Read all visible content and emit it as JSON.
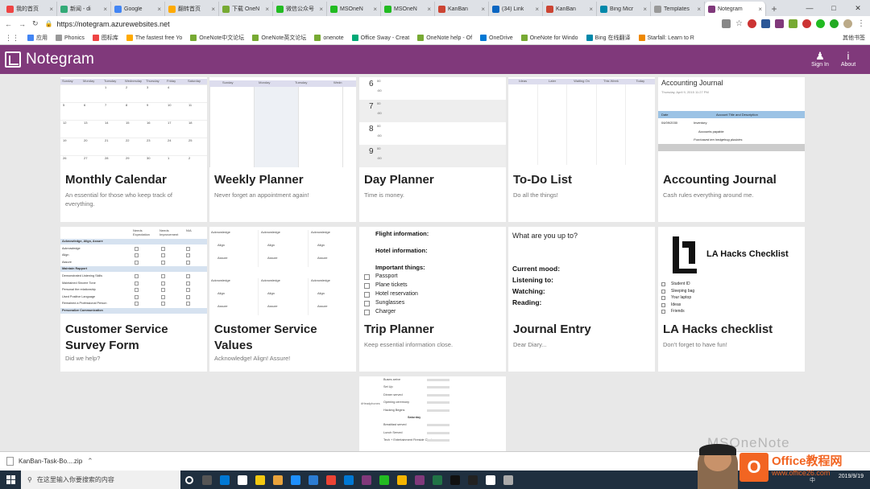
{
  "browser": {
    "tabs": [
      {
        "label": "我的首页",
        "color": "#e44"
      },
      {
        "label": "新闻 - di",
        "color": "#3a7"
      },
      {
        "label": "Google",
        "color": "#4285f4"
      },
      {
        "label": "翻转首页",
        "color": "#fa0"
      },
      {
        "label": "下载 OneN",
        "color": "#7a3"
      },
      {
        "label": "微信公众号",
        "color": "#2b2"
      },
      {
        "label": "MSOneN",
        "color": "#2b2"
      },
      {
        "label": "MSOneN",
        "color": "#2b2"
      },
      {
        "label": "KanBan",
        "color": "#c43"
      },
      {
        "label": "(34) Link",
        "color": "#0a66c2"
      },
      {
        "label": "KanBan",
        "color": "#c43"
      },
      {
        "label": "Bing Micr",
        "color": "#08a"
      },
      {
        "label": "Templates",
        "color": "#999"
      },
      {
        "label": "Notegram",
        "color": "#80397b",
        "active": true
      }
    ],
    "url": "https://notegram.azurewebsites.net",
    "bookmarks": [
      {
        "label": "应用",
        "color": "#4285f4"
      },
      {
        "label": "Phonics",
        "color": "#999"
      },
      {
        "label": "图标库",
        "color": "#e44"
      },
      {
        "label": "The fastest free Yo",
        "color": "#fa0"
      },
      {
        "label": "OneNote中文论坛",
        "color": "#7a3"
      },
      {
        "label": "OneNote英文论坛",
        "color": "#7a3"
      },
      {
        "label": "onenote",
        "color": "#7a3"
      },
      {
        "label": "Office Sway - Creat",
        "color": "#0a7"
      },
      {
        "label": "OneNote help - Of",
        "color": "#7a3"
      },
      {
        "label": "OneDrive",
        "color": "#0078d4"
      },
      {
        "label": "OneNote for Windo",
        "color": "#7a3"
      },
      {
        "label": "Bing 在线翻译",
        "color": "#08a"
      },
      {
        "label": "Starfall: Learn to R",
        "color": "#e80"
      }
    ],
    "other_bookmarks": "其他书签"
  },
  "app": {
    "name": "Notegram",
    "sign_in": "Sign In",
    "about": "About",
    "brand_color": "#80397b"
  },
  "cards": [
    {
      "title": "Monthly Calendar",
      "desc": "An essential for those who keep track of everything."
    },
    {
      "title": "Weekly Planner",
      "desc": "Never forget an appointment again!"
    },
    {
      "title": "Day Planner",
      "desc": "Time is money."
    },
    {
      "title": "To-Do List",
      "desc": "Do all the things!"
    },
    {
      "title": "Accounting Journal",
      "desc": "Cash rules everything around me."
    },
    {
      "title": "Customer Service Survey Form",
      "desc": "Did we help?"
    },
    {
      "title": "Customer Service Values",
      "desc": "Acknowledge! Align! Assure!"
    },
    {
      "title": "Trip Planner",
      "desc": "Keep essential information close."
    },
    {
      "title": "Journal Entry",
      "desc": "Dear Diary..."
    },
    {
      "title": "LA Hacks checklist",
      "desc": "Don't forget to have fun!"
    }
  ],
  "thumbs": {
    "monthly_days": [
      "Sunday",
      "Monday",
      "Tuesday",
      "Wednesday",
      "Thursday",
      "Friday",
      "Saturday"
    ],
    "monthly_rows": [
      [
        "",
        "",
        "1",
        "2",
        "3",
        "4"
      ],
      [
        "5",
        "6",
        "7",
        "8",
        "9",
        "10",
        "11"
      ],
      [
        "12",
        "13",
        "14",
        "15",
        "16",
        "17",
        "18"
      ],
      [
        "19",
        "20",
        "21",
        "22",
        "23",
        "24",
        "25"
      ],
      [
        "26",
        "27",
        "28",
        "29",
        "30",
        "1",
        "2"
      ]
    ],
    "weekly_days": [
      "Sunday",
      "Monday",
      "Tuesday",
      "Wedn"
    ],
    "day_hours": [
      "6",
      "7",
      "8",
      "9"
    ],
    "day_sup": "00",
    "day_sub": ":00",
    "todo_cols": [
      "Ideas",
      "Later",
      "Waiting On",
      "This Week",
      "Today"
    ],
    "acct_title": "Accounting Journal",
    "acct_date": "Thursday, April 9, 2015     11:27 PM",
    "acct_h1": "Date",
    "acct_h2": "Account Title and Description",
    "acct_r1a": "04/09/2030",
    "acct_r1b": "Inventory",
    "acct_r2": "Accounts payable",
    "acct_r3": "Purchased ten hedgehog plushies",
    "survey_cols": [
      "Needs Expectation",
      "Needs Improvement",
      "N/A"
    ],
    "survey_rows": [
      "Acknowledge, Align, Assure",
      "Acknowledge",
      "Align",
      "Assure",
      "Maintain Rapport",
      "Demonstrated Listening Skills",
      "Maintained Sincere Tone",
      "Personal the relationship",
      "Used Positive Language",
      "Remained a Professional Person",
      "Personalize Communication"
    ],
    "values_cells": [
      "Acknowledge",
      "Align",
      "Assure"
    ],
    "trip_lines": [
      "Flight information:",
      "Hotel information:",
      "Important things:"
    ],
    "trip_items": [
      "Passport",
      "Plane tickets",
      "Hotel reservation",
      "Sunglasses",
      "Charger"
    ],
    "journal_q": "What are you up to?",
    "journal_lines": [
      "Current mood:",
      "Listening to:",
      "Watching:",
      "Reading:"
    ],
    "la_title": "LA Hacks Checklist",
    "la_items": [
      "Student ID",
      "Sleeping bag",
      "Your laptop",
      "Ideas",
      "Friends"
    ],
    "extra_lines": [
      "Buses arrive",
      "Set Up",
      "Dinner served",
      "Opening ceremony",
      "Hacking Begins",
      "Saturday",
      "Breakfast served",
      "Lunch Served",
      "Tech + Entertainment Fireside Chat"
    ],
    "extra_label": "#Headphones"
  },
  "download": {
    "file": "KanBan-Task-Bo....zip"
  },
  "taskbar": {
    "search_placeholder": "在这里输入你要搜索的内容",
    "time": "",
    "date": "2019/9/19",
    "ime": "中"
  },
  "watermark": {
    "top": "MSOneNote",
    "brand": "Office教程网",
    "site": "www.office26.com"
  }
}
